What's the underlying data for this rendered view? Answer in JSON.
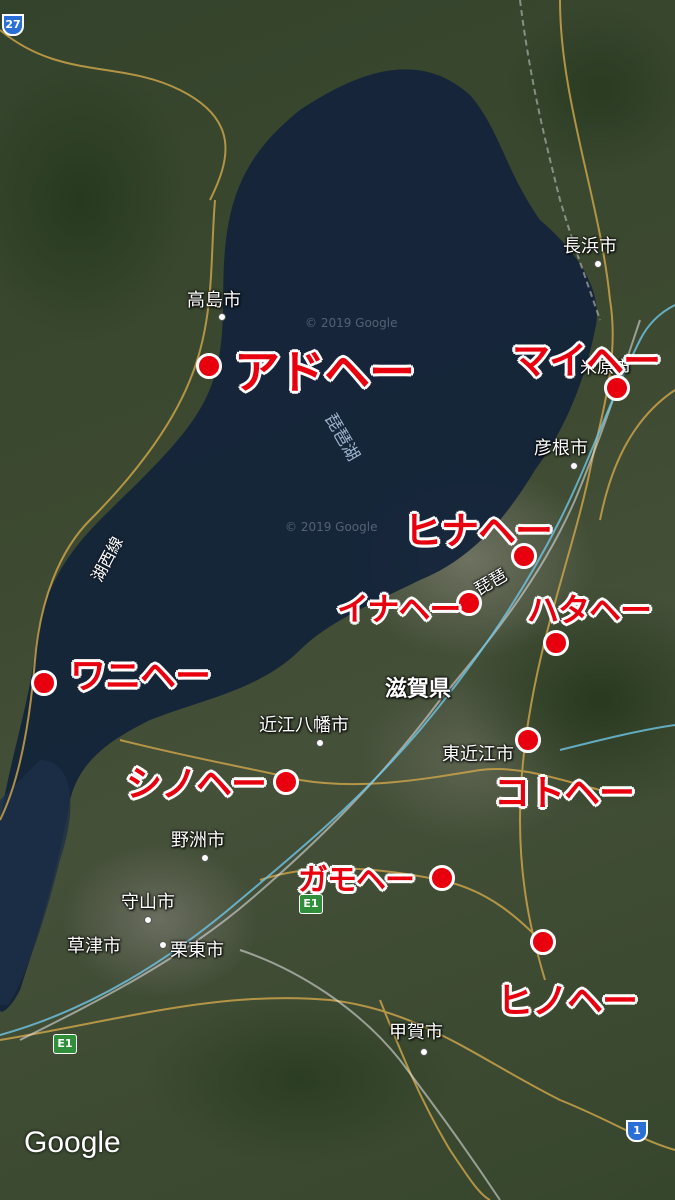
{
  "map": {
    "lake_name": "琵琶湖",
    "prefecture": "滋賀県",
    "copyright": "© 2019 Google",
    "logo": "Google",
    "rail_line": "湖西線",
    "inner_label": "琵琶",
    "road_shields": [
      "27",
      "E1",
      "E1",
      "1"
    ]
  },
  "cities": {
    "nagahama": "長浜市",
    "takashima": "高島市",
    "maibara": "米原市",
    "hikone": "彦根市",
    "omihachiman": "近江八幡市",
    "higashiomi": "東近江市",
    "yasu": "野洲市",
    "moriyama": "守山市",
    "kusatsu": "草津市",
    "ritto": "栗東市",
    "koka": "甲賀市"
  },
  "annotations": {
    "ado": "アドヘー",
    "mai": "マイヘー",
    "hina": "ヒナヘー",
    "ina": "イナヘー",
    "hata": "ハタヘー",
    "wani": "ワニヘー",
    "shino": "シノヘー",
    "koto": "コトヘー",
    "gamo": "ガモヘー",
    "hino": "ヒノヘー"
  },
  "colors": {
    "marker": "#e8000f",
    "lake": "#14243a",
    "road": "#c9a24a",
    "rail": "#6fc6e6"
  }
}
